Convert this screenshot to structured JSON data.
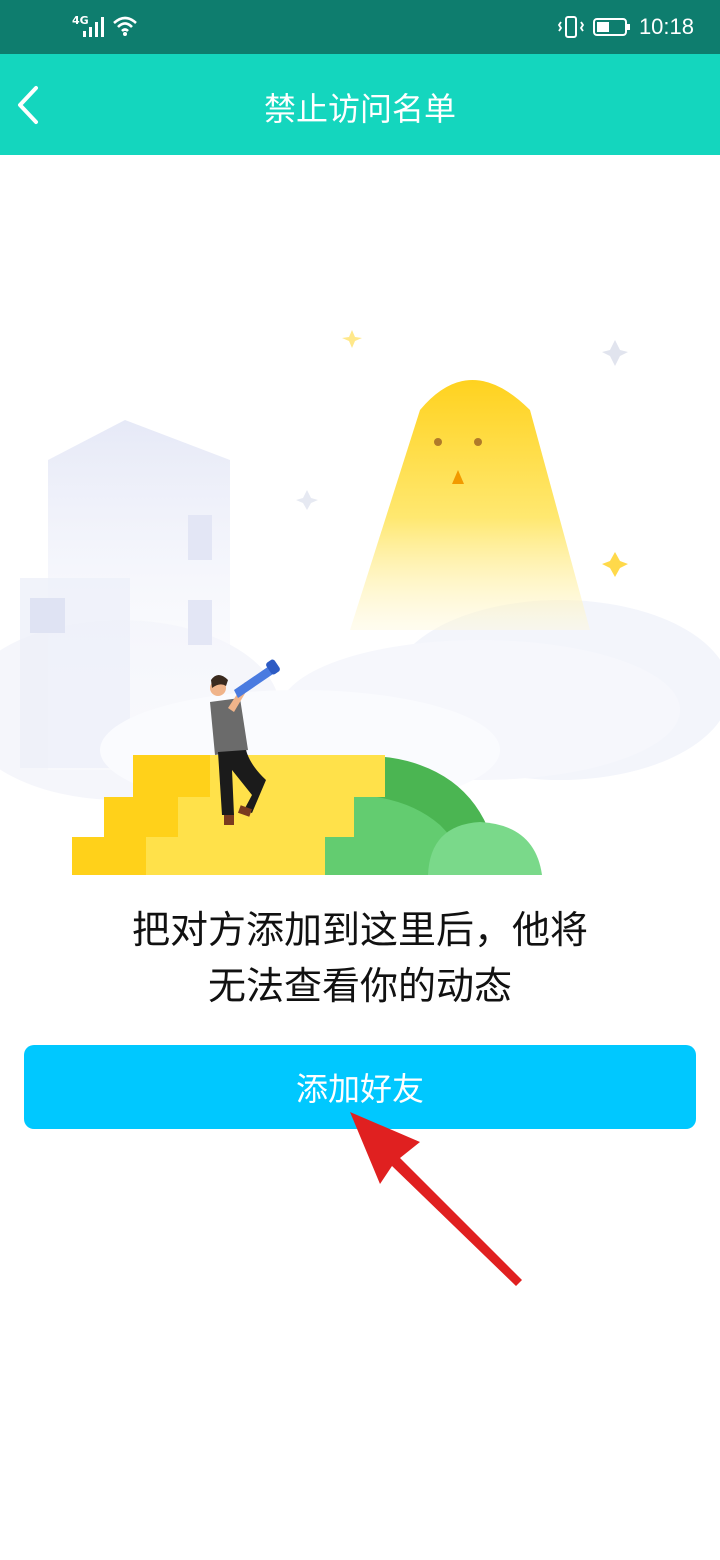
{
  "status_bar": {
    "network": "4G",
    "time": "10:18"
  },
  "header": {
    "title": "禁止访问名单"
  },
  "illustration": {
    "icon": "telescope-person-illustration"
  },
  "main": {
    "description_line1": "把对方添加到这里后，他将",
    "description_line2": "无法查看你的动态",
    "add_button_label": "添加好友"
  },
  "colors": {
    "status_bar": "#0e7d6e",
    "app_bar": "#14d6be",
    "button": "#00c8ff",
    "arrow": "#e02020"
  }
}
